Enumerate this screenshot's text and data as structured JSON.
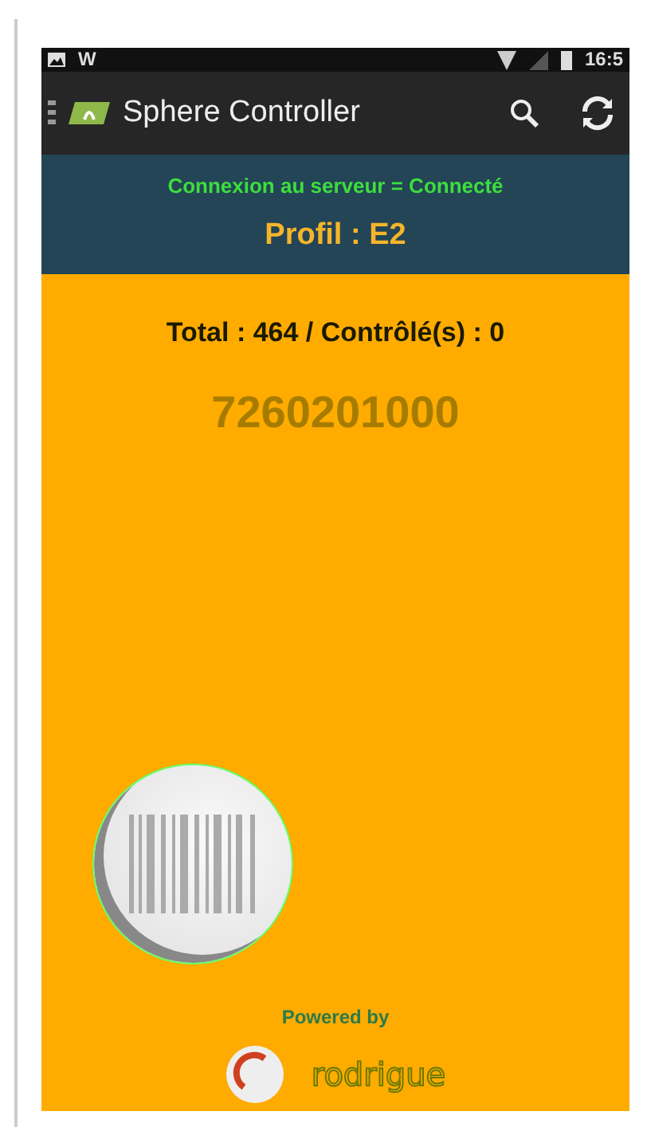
{
  "status_bar": {
    "left": "W",
    "time": "16:5"
  },
  "app_bar": {
    "title": "Sphere Controller"
  },
  "connection": {
    "text": "Connexion au serveur = Connecté",
    "connected": true
  },
  "profile": "Profil : E2",
  "totals": "Total : 464 / Contrôlé(s) : 0",
  "last_code": "7260201000",
  "footer": {
    "powered_by": "Powered by",
    "brand": "rodrigue"
  }
}
